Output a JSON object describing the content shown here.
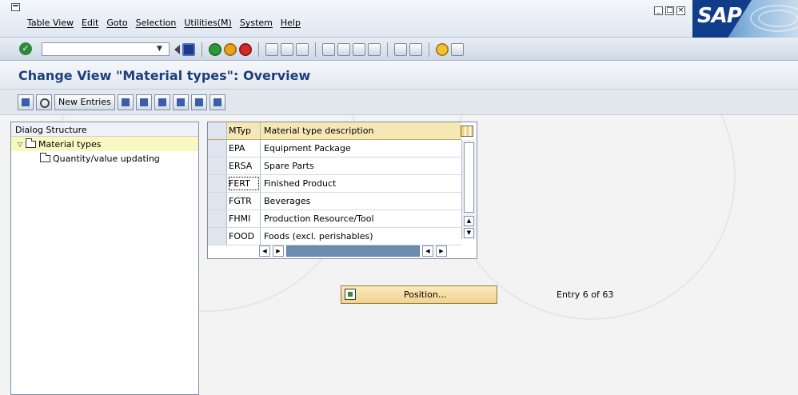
{
  "window": {
    "menu_items": [
      "Table View",
      "Edit",
      "Goto",
      "Selection",
      "Utilities(M)",
      "System",
      "Help"
    ],
    "brand": "SAP"
  },
  "system_toolbar": {
    "command_value": ""
  },
  "title": "Change View \"Material types\": Overview",
  "app_toolbar": {
    "new_entries_label": "New Entries"
  },
  "dialog_structure": {
    "header": "Dialog Structure",
    "items": [
      {
        "label": "Material types",
        "level": 0,
        "expanded": true,
        "selected": true
      },
      {
        "label": "Quantity/value updating",
        "level": 1,
        "expanded": false,
        "selected": false
      }
    ]
  },
  "table": {
    "columns": [
      "MTyp",
      "Material type description"
    ],
    "rows": [
      [
        "EPA",
        "Equipment Package"
      ],
      [
        "ERSA",
        "Spare Parts"
      ],
      [
        "FERT",
        "Finished Product"
      ],
      [
        "FGTR",
        "Beverages"
      ],
      [
        "FHMI",
        "Production Resource/Tool"
      ],
      [
        "FOOD",
        "Foods (excl. perishables)"
      ]
    ]
  },
  "position_button_label": "Position...",
  "entry_text": "Entry 6 of 63"
}
